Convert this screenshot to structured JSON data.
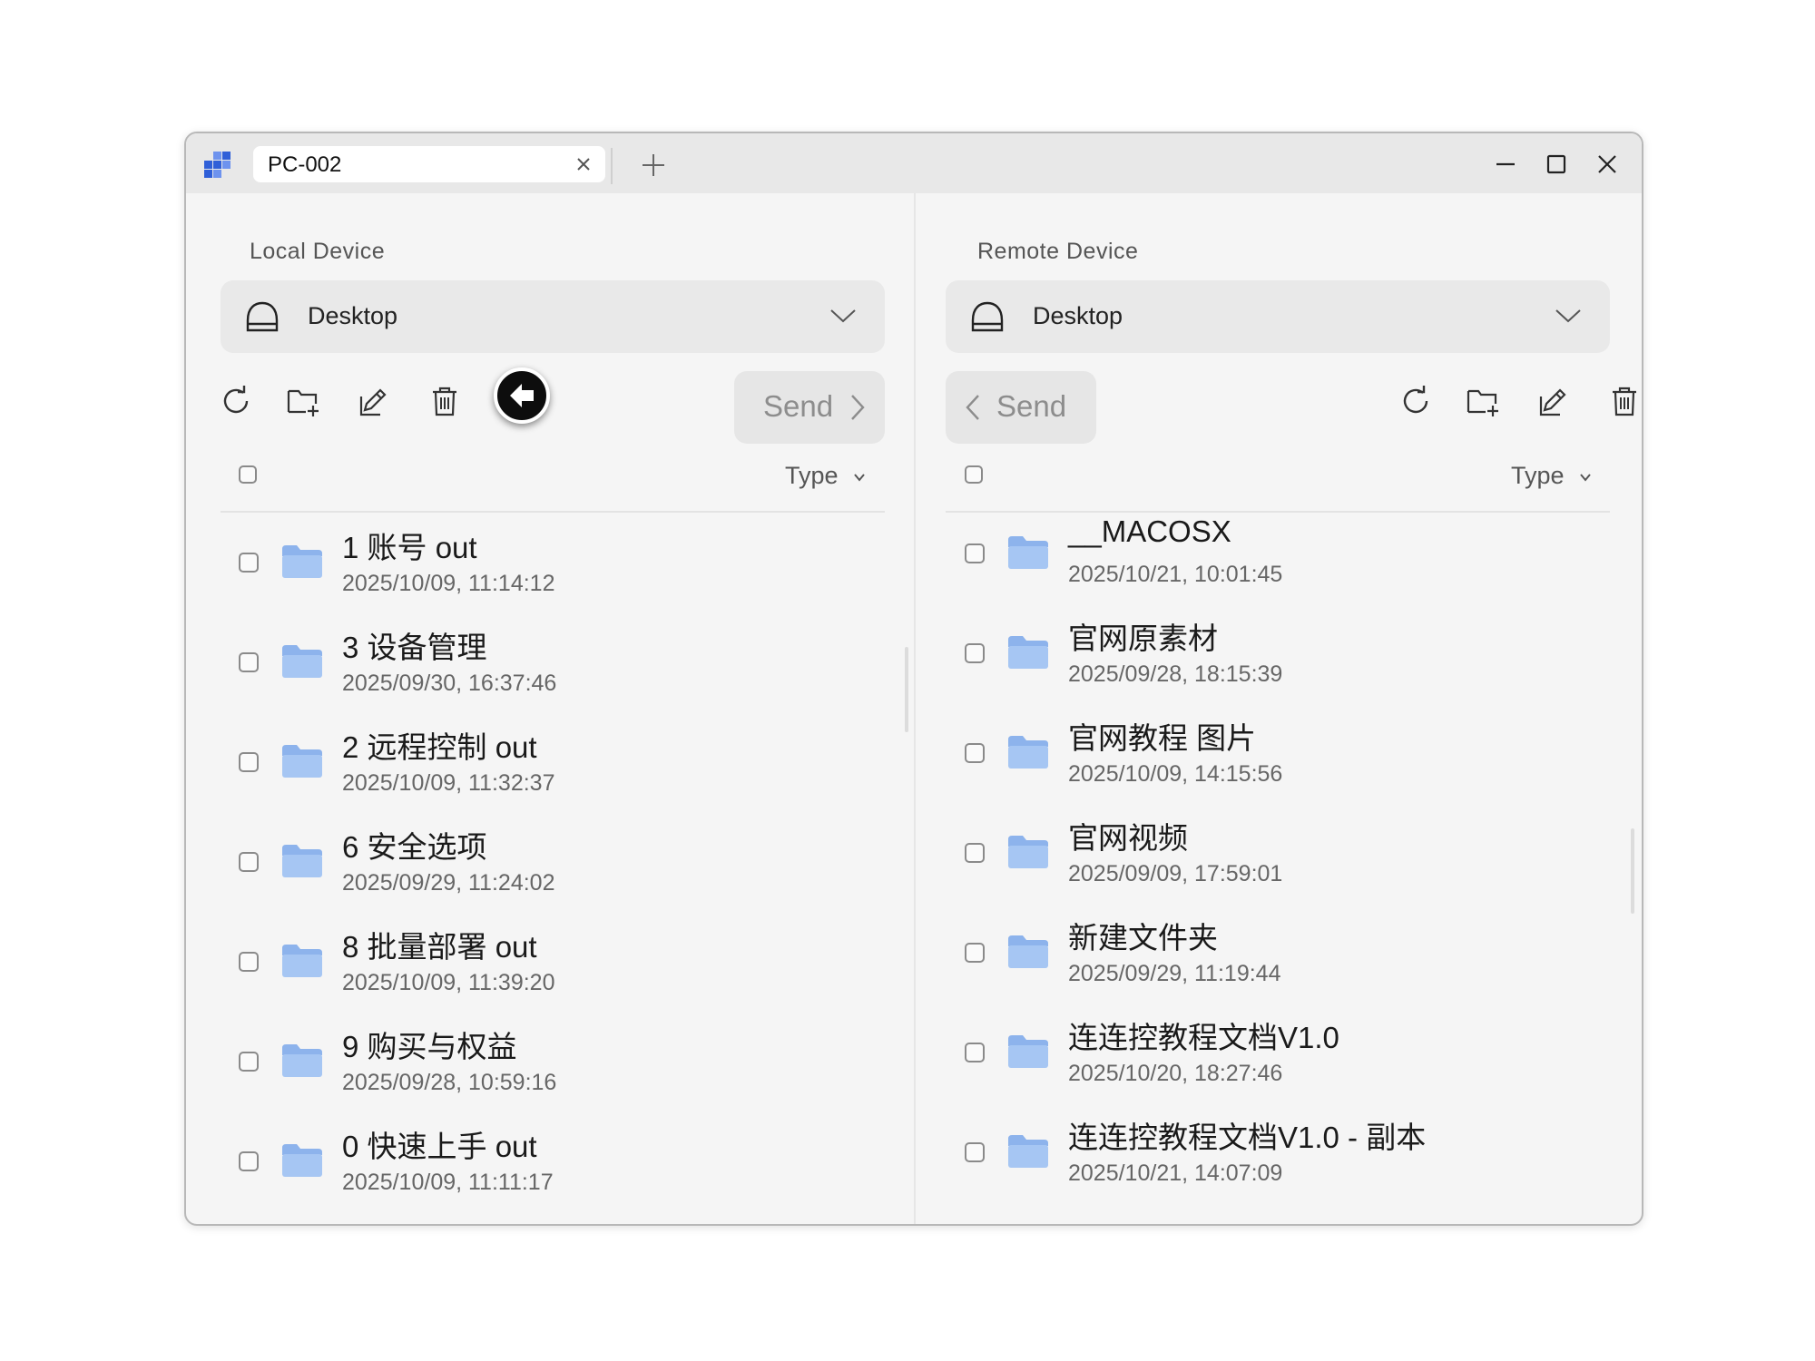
{
  "colors": {
    "window_bg": "#f5f5f5",
    "titlebar_bg": "#e8e8e8",
    "folder_blue": "#9cbff1",
    "logo_blue": "#2f5fd8",
    "send_disabled_text": "#8d8d8d"
  },
  "titlebar": {
    "tab_title": "PC-002",
    "icons": [
      "app-logo-icon",
      "close-icon",
      "plus-icon",
      "minimize-icon",
      "maximize-icon",
      "close-window-icon"
    ]
  },
  "local": {
    "label": "Local Device",
    "location": "Desktop",
    "send_label": "Send",
    "sort_label": "Type",
    "toolbar_icons": [
      "refresh-icon",
      "new-folder-icon",
      "rename-icon",
      "trash-icon",
      "back-arrow-icon"
    ],
    "files": [
      {
        "name": "1 账号 out",
        "date": "2025/10/09, 11:14:12"
      },
      {
        "name": "3 设备管理",
        "date": "2025/09/30, 16:37:46"
      },
      {
        "name": "2 远程控制 out",
        "date": "2025/10/09, 11:32:37"
      },
      {
        "name": "6 安全选项",
        "date": "2025/09/29, 11:24:02"
      },
      {
        "name": "8 批量部署 out",
        "date": "2025/10/09, 11:39:20"
      },
      {
        "name": "9 购买与权益",
        "date": "2025/09/28, 10:59:16"
      },
      {
        "name": "0 快速上手 out",
        "date": "2025/10/09, 11:11:17"
      }
    ]
  },
  "remote": {
    "label": "Remote Device",
    "location": "Desktop",
    "send_label": "Send",
    "sort_label": "Type",
    "toolbar_icons": [
      "refresh-icon",
      "new-folder-icon",
      "rename-icon",
      "trash-icon"
    ],
    "files": [
      {
        "name": "__MACOSX",
        "date": "2025/10/21, 10:01:45"
      },
      {
        "name": "官网原素材",
        "date": "2025/09/28, 18:15:39"
      },
      {
        "name": "官网教程 图片",
        "date": "2025/10/09, 14:15:56"
      },
      {
        "name": "官网视频",
        "date": "2025/09/09, 17:59:01"
      },
      {
        "name": "新建文件夹",
        "date": "2025/09/29, 11:19:44"
      },
      {
        "name": "连连控教程文档V1.0",
        "date": "2025/10/20, 18:27:46"
      },
      {
        "name": "连连控教程文档V1.0 - 副本",
        "date": "2025/10/21, 14:07:09"
      }
    ]
  }
}
